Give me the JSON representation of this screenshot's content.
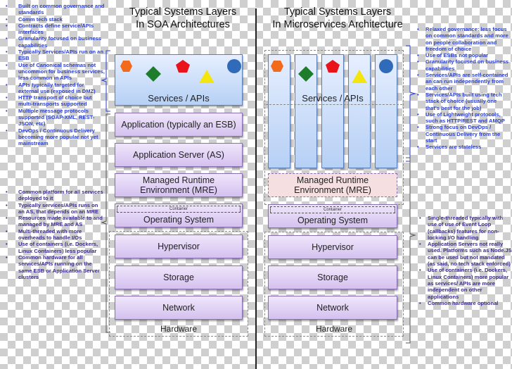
{
  "soa": {
    "title_line1": "Typical Systems Layers",
    "title_line2": "In SOA Architectures",
    "services_label": "Services / APIs",
    "layers": {
      "application": "Application (typically an ESB)",
      "app_server": "Application Server (AS)",
      "mre_line1": "Managed Runtime",
      "mre_line2": "Environment (MRE)",
      "container": "Container",
      "os": "Operating System",
      "hypervisor": "Hypervisor",
      "storage": "Storage",
      "network": "Network",
      "hardware": "Hardware"
    },
    "notes_top": [
      "Built on common governance and standards",
      "Comm tech stack",
      "Contracts define service/APIs interfaces",
      "Granularity focused on business capabilities",
      "Typically Services/APIs run on an ESB",
      "Use of Canonical schemas not uncommon for business services, less common in APIs",
      "APIs typically targeted for external use (exposed in DMZ)",
      "HTTP transport of choice but multi-transports supported",
      "Multiple message protocols supported (SOAP-XML, REST-JSON, etc)",
      "DevOps / Continuous Delivery becoming more popular not yet mainstream"
    ],
    "notes_bottom": [
      "Common platform for all services deployed to it",
      "Typically services/APIs runs on an AS, that depends on an MRE",
      "Resources made available to and managed by MRE and AS",
      "Multi-threaded with more overheads to handle I/Os",
      "Use of containers (i.e. Dockers, Linux Containers) less popular",
      "Common hardware for all services/APIs running on the same ESB or Application Server clusters"
    ]
  },
  "microservices": {
    "title_line1": "Typical Systems Layers",
    "title_line2": "In Microservices Architecture",
    "services_label": "Services / APIs",
    "layers": {
      "mre_line1": "Managed Runtime",
      "mre_line2": "Environment (MRE)",
      "container": "Container",
      "os": "Operating System",
      "hypervisor": "Hypervisor",
      "storage": "Storage",
      "network": "Network",
      "hardware": "Hardware"
    },
    "notes_top": [
      "Relaxed governance: less focus on common standards and more on people collaboration and freedom of choice",
      "Use of ESBs not popular",
      "Granularity focused on business capabilities",
      "Services/APIs are self-contained an can run independently from each other",
      "Services/APIs built using tech stack of choice (usually one that's best for the job)",
      "Use of Lightweight protocols, such as HTTP/REST and AMQP",
      "Strong focus on DevOps / Continuous Delivery from the start",
      "Services are stateless"
    ],
    "notes_bottom": [
      "Single-threaded typically with use of use of Event Loop (callbacks) features for non-locking I/O handling",
      "Application Servers not really used. Platforms such as Node.JS can be used but not mandated (as said, no tech stack enforced)",
      "Use of containers (i.e. Dockers, Linux Containers) more popular as services/ APIs are more independent on other applications",
      "Common hardware optional"
    ]
  },
  "shapes": [
    {
      "name": "hexagon",
      "color": "#f26a1b"
    },
    {
      "name": "diamond",
      "color": "#1e7d2a"
    },
    {
      "name": "pentagon",
      "color": "#e8131b"
    },
    {
      "name": "triangle",
      "color": "#f5e50f"
    },
    {
      "name": "circle",
      "color": "#2f6bb8"
    }
  ],
  "colors": {
    "note_blue": "#2b3fd1",
    "note_purple": "#3b2a8c",
    "layer_border": "#8a6fb0",
    "services_fill": "#b6d0f5",
    "mre_microservices_fill": "#f6dfe0"
  }
}
